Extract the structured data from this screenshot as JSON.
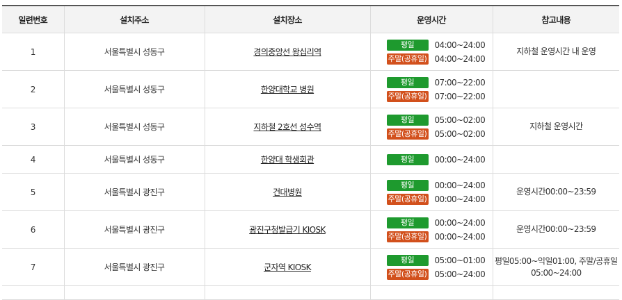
{
  "table": {
    "headers": [
      "일련번호",
      "설치주소",
      "설치장소",
      "운영시간",
      "참고내용"
    ],
    "weekday_label": "평일",
    "weekend_label": "주말(공휴일)",
    "colors": {
      "weekday": "#1e9a2e",
      "weekend": "#d2501c"
    },
    "rows": [
      {
        "no": "1",
        "address": "서울특별시 성동구",
        "place": "경의중앙선 왕십리역",
        "weekday_time": "04:00~24:00",
        "weekend_time": "04:00~24:00",
        "note": "지하철 운영시간 내 운영"
      },
      {
        "no": "2",
        "address": "서울특별시 성동구",
        "place": "한양대학교 병원",
        "weekday_time": "07:00~22:00",
        "weekend_time": "07:00~22:00",
        "note": ""
      },
      {
        "no": "3",
        "address": "서울특별시 성동구",
        "place": "지하철 2호선 성수역",
        "weekday_time": "05:00~02:00",
        "weekend_time": "05:00~02:00",
        "note": "지하철 운영시간"
      },
      {
        "no": "4",
        "address": "서울특별시 성동구",
        "place": "한양대 학생회관",
        "weekday_time": "00:00~24:00",
        "weekend_time": "",
        "note": ""
      },
      {
        "no": "5",
        "address": "서울특별시 광진구",
        "place": "건대병원",
        "weekday_time": "00:00~24:00",
        "weekend_time": "00:00~24:00",
        "note": "운영시간00:00~23:59"
      },
      {
        "no": "6",
        "address": "서울특별시 광진구",
        "place": "광진구청발급기 KIOSK",
        "weekday_time": "00:00~24:00",
        "weekend_time": "00:00~24:00",
        "note": "운영시간00:00~23:59"
      },
      {
        "no": "7",
        "address": "서울특별시 광진구",
        "place": "군자역 KIOSK",
        "weekday_time": "05:00~01:00",
        "weekend_time": "05:00~24:00",
        "note": "평일05:00~익일01:00, 주말/공휴일 05:00~24:00"
      }
    ]
  }
}
